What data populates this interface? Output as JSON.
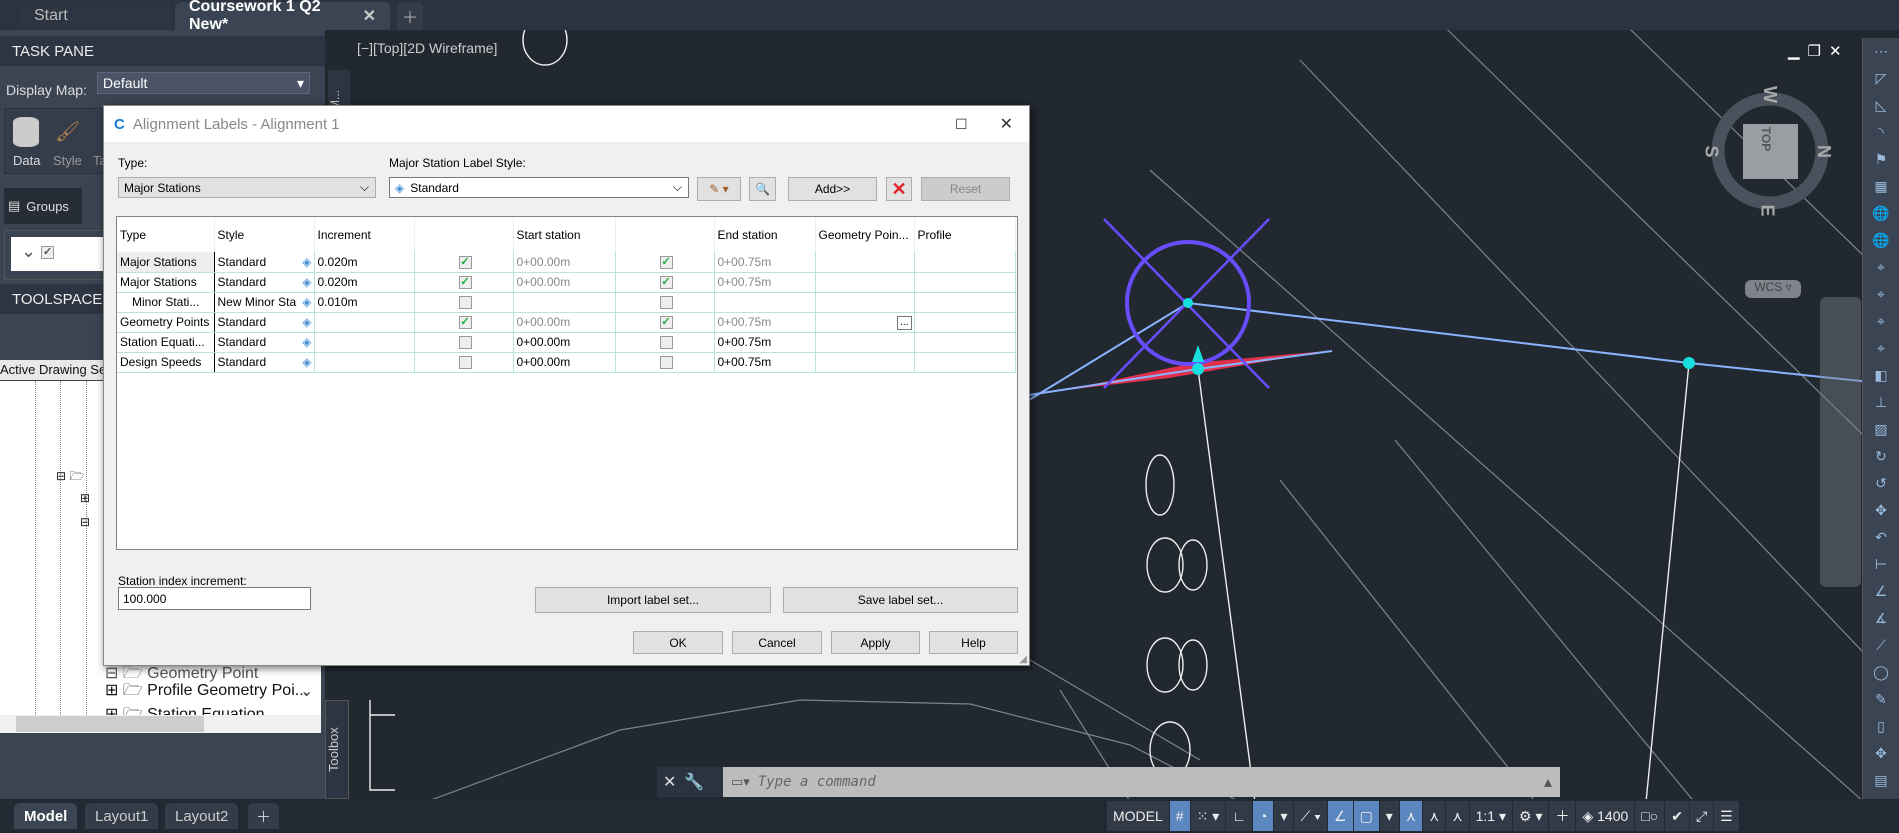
{
  "tabs": [
    {
      "label": "Start",
      "active": false
    },
    {
      "label": "Coursework 1 Q2 New*",
      "active": true
    }
  ],
  "new_tab_icon": "plus-icon",
  "task_pane": {
    "title": "TASK PANE",
    "display_map_label": "Display Map:",
    "display_map_value": "Default",
    "tools": [
      "Data",
      "Style",
      "Ta"
    ],
    "groups_label": "Groups",
    "side_tab": "M..."
  },
  "toolspace": {
    "title": "TOOLSPACE",
    "tab": "Active Drawing Set",
    "tree_items": [
      "Geometry Point",
      "Profile Geometry Poi...",
      "Station Equation"
    ],
    "toolbox_tab": "Toolbox"
  },
  "viewport": {
    "label": "[−][Top][2D Wireframe]",
    "viewcube": {
      "top": "TOP",
      "n": "N",
      "s": "S",
      "e": "E",
      "w": "W",
      "ucs": "WCS"
    },
    "colors": {
      "alignment": "#8ab4ff",
      "marker": "#6a4cff",
      "triangle": "#e0304a",
      "point": "#19e0e0"
    }
  },
  "dialog": {
    "title": "Alignment Labels - Alignment 1",
    "type_label": "Type:",
    "type_value": "Major Stations",
    "style_label": "Major Station Label Style:",
    "style_value": "Standard",
    "add_button": "Add>>",
    "reset_button": "Reset",
    "columns": [
      "Type",
      "Style",
      "Increment",
      "",
      "Start station",
      "",
      "End station",
      "Geometry Poin...",
      "Profile"
    ],
    "rows": [
      {
        "type": "Major Stations",
        "style": "Standard",
        "increment": "0.020m",
        "start_checked": true,
        "start": "0+00.00m",
        "end_checked": true,
        "end": "0+00.75m",
        "geometry": "",
        "profile": ""
      },
      {
        "type": "Major Stations",
        "style": "Standard",
        "increment": "0.020m",
        "start_checked": true,
        "start": "0+00.00m",
        "end_checked": true,
        "end": "0+00.75m",
        "geometry": "",
        "profile": ""
      },
      {
        "type": "Minor Stati...",
        "style": "New Minor Sta",
        "increment": "0.010m",
        "start_checked": false,
        "start": "",
        "end_checked": false,
        "end": "",
        "geometry": "",
        "profile": ""
      },
      {
        "type": "Geometry Points",
        "style": "Standard",
        "increment": "",
        "start_checked": true,
        "start": "0+00.00m",
        "end_checked": true,
        "end": "0+00.75m",
        "geometry": "...",
        "profile": ""
      },
      {
        "type": "Station Equati...",
        "style": "Standard",
        "increment": "",
        "start_checked": false,
        "start": "0+00.00m",
        "end_checked": false,
        "end": "0+00.75m",
        "geometry": "",
        "profile": ""
      },
      {
        "type": "Design Speeds",
        "style": "Standard",
        "increment": "",
        "start_checked": false,
        "start": "0+00.00m",
        "end_checked": false,
        "end": "0+00.75m",
        "geometry": "",
        "profile": ""
      }
    ],
    "station_index_label": "Station index increment:",
    "station_index_value": "100.000",
    "import_button": "Import label set...",
    "save_button": "Save label set...",
    "ok": "OK",
    "cancel": "Cancel",
    "apply": "Apply",
    "help": "Help"
  },
  "command_line": {
    "placeholder": "Type a command"
  },
  "layout_tabs": [
    {
      "label": "Model",
      "active": true
    },
    {
      "label": "Layout1"
    },
    {
      "label": "Layout2"
    }
  ],
  "status_bar": {
    "model": "MODEL",
    "scale": "1:1",
    "count": "1400"
  }
}
